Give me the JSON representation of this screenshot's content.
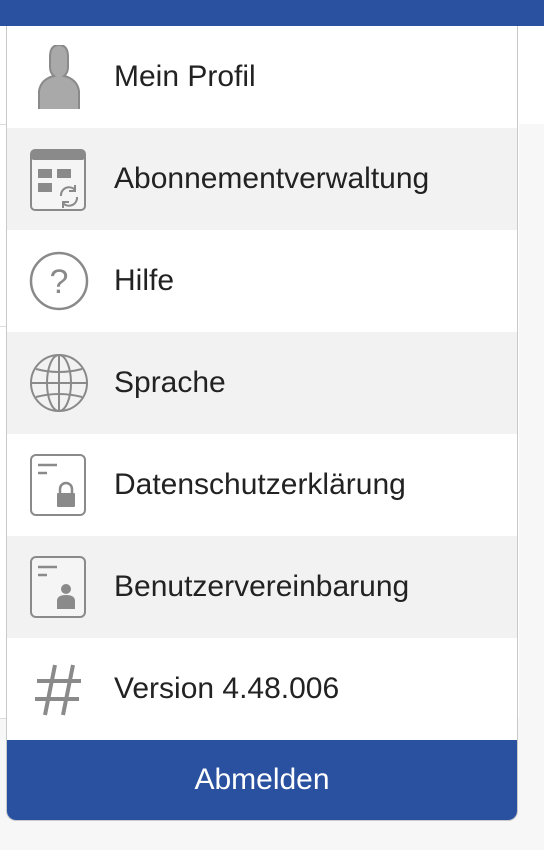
{
  "menu": {
    "items": [
      {
        "label": "Mein Profil",
        "icon": "profile-icon"
      },
      {
        "label": "Abonnementverwaltung",
        "icon": "subscription-icon"
      },
      {
        "label": "Hilfe",
        "icon": "help-icon"
      },
      {
        "label": "Sprache",
        "icon": "globe-icon"
      },
      {
        "label": "Datenschutzerklärung",
        "icon": "privacy-document-icon"
      },
      {
        "label": "Benutzervereinbarung",
        "icon": "user-agreement-icon"
      },
      {
        "label": "Version 4.48.006",
        "icon": "hash-icon"
      }
    ],
    "logout_label": "Abmelden"
  },
  "colors": {
    "accent": "#2a51a0",
    "row_alt": "#f2f2f2",
    "icon_gray": "#8a8a8a",
    "text": "#222222"
  }
}
